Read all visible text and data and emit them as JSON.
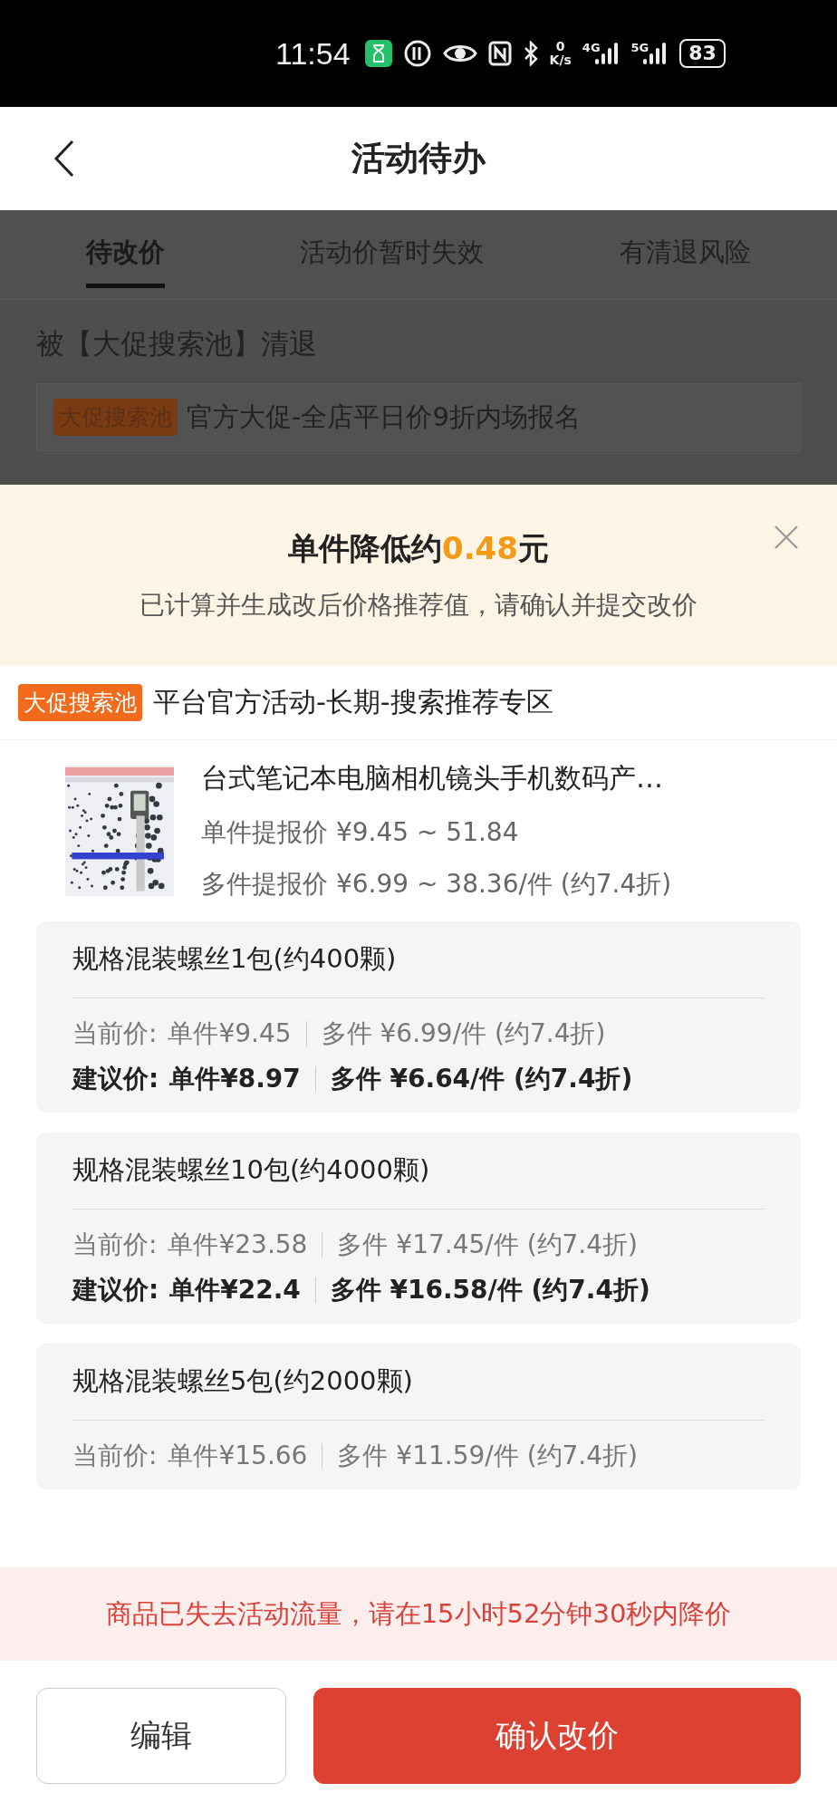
{
  "status_bar": {
    "time": "11:54",
    "network_speed_value": "0",
    "network_speed_unit": "K/s",
    "signal_1_label": "4G",
    "signal_2_label": "5G",
    "battery": "83"
  },
  "header": {
    "title": "活动待办"
  },
  "tabs": [
    {
      "label": "待改价",
      "selected": true
    },
    {
      "label": "活动价暂时失效",
      "selected": false
    },
    {
      "label": "有清退风险",
      "selected": false
    }
  ],
  "background_content": {
    "notice": "被【大促搜索池】清退",
    "activity": {
      "tag": "大促搜索池",
      "name": "官方大促-全店平日价9折内场报名"
    }
  },
  "sheet": {
    "headline_prefix": "单件降低约",
    "headline_amount": "0.48",
    "headline_suffix": "元",
    "subtitle": "已计算并生成改后价格推荐值，请确认并提交改价",
    "activity": {
      "tag": "大促搜索池",
      "name": "平台官方活动-长期-搜索推荐专区"
    },
    "product": {
      "title": "台式笔记本电脑相机镜头手机数码产…",
      "single_price": "单件提报价 ¥9.45 ~ 51.84",
      "multi_price": "多件提报价 ¥6.99 ~ 38.36/件 (约7.4折)"
    },
    "specs": [
      {
        "name": "规格混装螺丝1包(约400颗)",
        "rows": [
          {
            "kind": "current",
            "label": "当前价:",
            "single": "单件¥9.45",
            "multi": "多件 ¥6.99/件 (约7.4折)"
          },
          {
            "kind": "suggested",
            "label": "建议价:",
            "single": "单件¥8.97",
            "multi": "多件 ¥6.64/件 (约7.4折)"
          }
        ]
      },
      {
        "name": "规格混装螺丝10包(约4000颗)",
        "rows": [
          {
            "kind": "current",
            "label": "当前价:",
            "single": "单件¥23.58",
            "multi": "多件 ¥17.45/件 (约7.4折)"
          },
          {
            "kind": "suggested",
            "label": "建议价:",
            "single": "单件¥22.4",
            "multi": "多件 ¥16.58/件 (约7.4折)"
          }
        ]
      },
      {
        "name": "规格混装螺丝5包(约2000颗)",
        "rows": [
          {
            "kind": "current",
            "label": "当前价:",
            "single": "单件¥15.66",
            "multi": "多件 ¥11.59/件 (约7.4折)"
          }
        ]
      }
    ],
    "warning": "商品已失去活动流量，请在15小时52分钟30秒内降价",
    "buttons": [
      {
        "kind": "secondary",
        "label": "编辑"
      },
      {
        "kind": "primary",
        "label": "确认改价"
      }
    ]
  }
}
